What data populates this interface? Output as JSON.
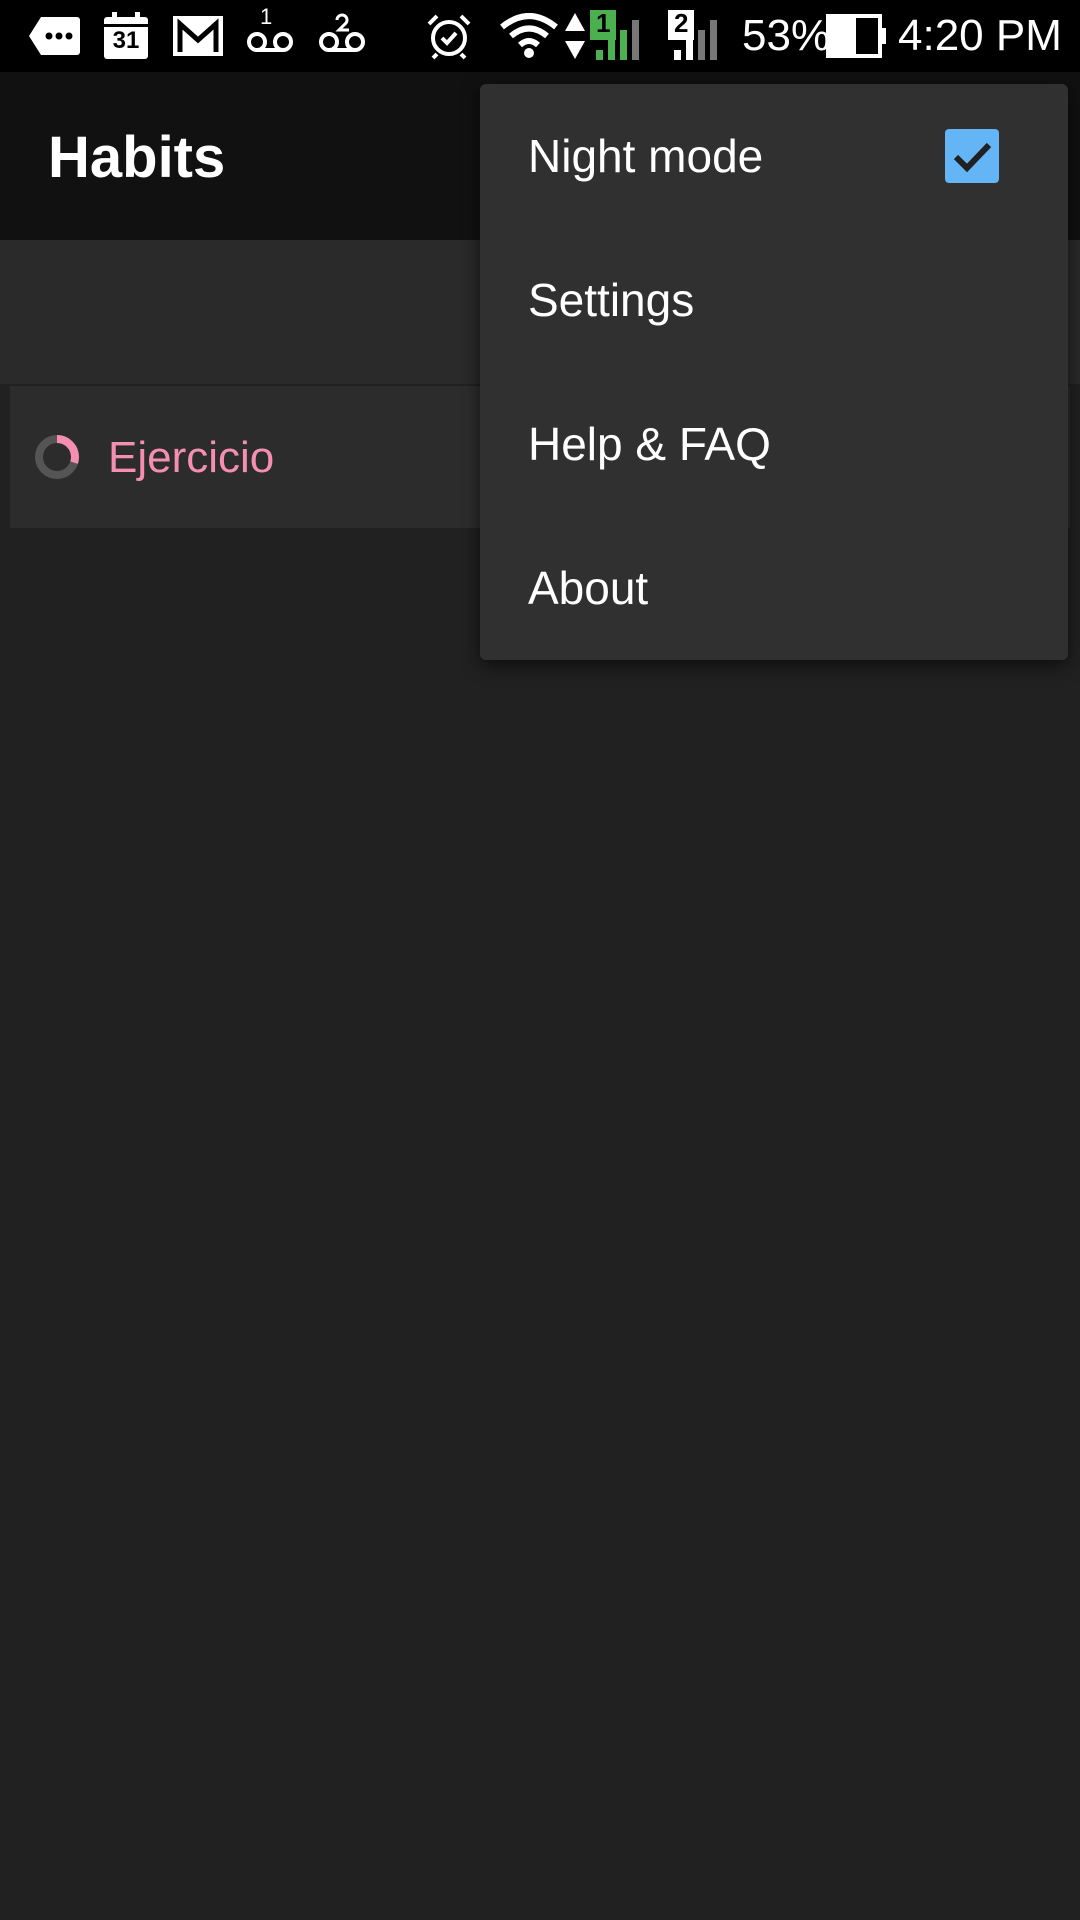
{
  "status_bar": {
    "battery_percent": "53%",
    "time": "4:20 PM",
    "calendar_day": "31",
    "sim1_label": "1",
    "sim2_label": "2",
    "voicemail_count": "1",
    "icons": [
      "messaging-icon",
      "calendar-icon",
      "gmail-icon",
      "voicemail-icon",
      "voicemail-icon",
      "alarm-icon",
      "wifi-icon",
      "signal-sim1-icon",
      "signal-sim2-icon",
      "battery-icon"
    ],
    "sim1_color": "#4caf50"
  },
  "app_bar": {
    "title": "Habits"
  },
  "habits": [
    {
      "name": "Ejercicio",
      "color": "#f48fb1",
      "progress": 0.3
    }
  ],
  "menu": {
    "items": [
      {
        "label": "Night mode",
        "checked": true
      },
      {
        "label": "Settings"
      },
      {
        "label": "Help & FAQ"
      },
      {
        "label": "About"
      }
    ],
    "checkbox_color": "#64b5f6"
  }
}
